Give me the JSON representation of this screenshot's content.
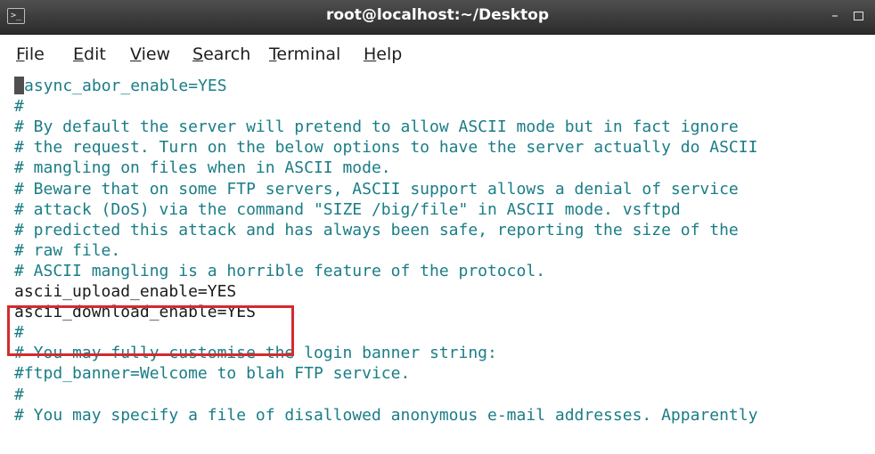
{
  "window": {
    "title": "root@localhost:~/Desktop",
    "icon": "terminal-icon",
    "controls": [
      "minimize-icon",
      "maximize-icon"
    ]
  },
  "menubar": {
    "items": [
      "File",
      "Edit",
      "View",
      "Search",
      "Terminal",
      "Help"
    ]
  },
  "terminal": {
    "lines": [
      {
        "text": "async_abor_enable=YES",
        "kind": "comment",
        "cursor_prefix": "#"
      },
      {
        "text": "#",
        "kind": "comment"
      },
      {
        "text": "# By default the server will pretend to allow ASCII mode but in fact ignore",
        "kind": "comment"
      },
      {
        "text": "# the request. Turn on the below options to have the server actually do ASCII",
        "kind": "comment"
      },
      {
        "text": "# mangling on files when in ASCII mode.",
        "kind": "comment"
      },
      {
        "text": "# Beware that on some FTP servers, ASCII support allows a denial of service",
        "kind": "comment"
      },
      {
        "text": "# attack (DoS) via the command \"SIZE /big/file\" in ASCII mode. vsftpd",
        "kind": "comment"
      },
      {
        "text": "# predicted this attack and has always been safe, reporting the size of the",
        "kind": "comment"
      },
      {
        "text": "# raw file.",
        "kind": "comment"
      },
      {
        "text": "# ASCII mangling is a horrible feature of the protocol.",
        "kind": "comment"
      },
      {
        "text": "ascii_upload_enable=YES",
        "kind": "plain"
      },
      {
        "text": "ascii_download_enable=YES",
        "kind": "plain"
      },
      {
        "text": "#",
        "kind": "comment"
      },
      {
        "text": "# You may fully customise the login banner string:",
        "kind": "comment"
      },
      {
        "text": "#ftpd_banner=Welcome to blah FTP service.",
        "kind": "comment"
      },
      {
        "text": "#",
        "kind": "comment"
      },
      {
        "text": "# You may specify a file of disallowed anonymous e-mail addresses. Apparently",
        "kind": "comment"
      }
    ]
  },
  "colors": {
    "comment": "#1a7d86",
    "plain": "#1a1a1a",
    "highlight": "#d42a2f",
    "titlebar": "#3a3a3a"
  }
}
